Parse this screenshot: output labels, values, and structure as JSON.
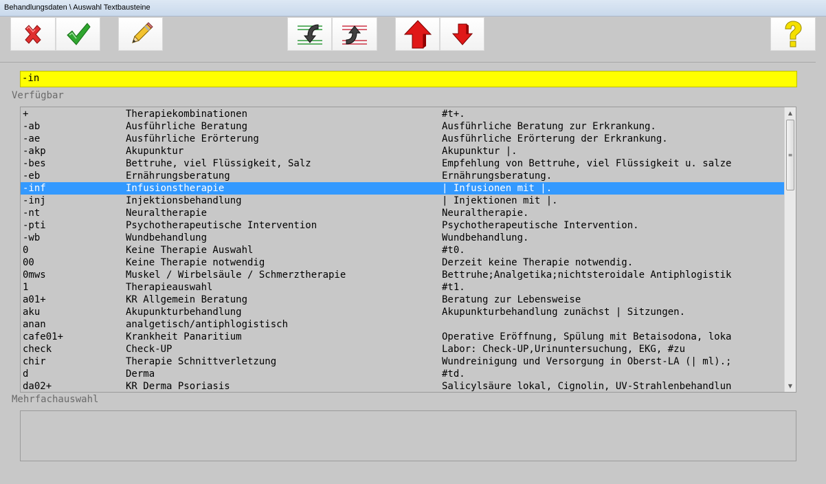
{
  "window": {
    "title": "Behandlungsdaten \\ Auswahl Textbausteine"
  },
  "toolbar": {
    "cancel_icon": "red-x-icon",
    "ok_icon": "green-check-icon",
    "edit_icon": "pencil-icon",
    "move_down_icon": "curved-arrow-down-icon",
    "move_up_icon": "curved-arrow-up-icon",
    "up_icon": "red-arrow-up-icon",
    "down_icon": "red-arrow-down-icon",
    "help_icon": "yellow-question-icon"
  },
  "search": {
    "value": "-in"
  },
  "available": {
    "label": "Verfügbar",
    "selected_index": 6,
    "rows": [
      {
        "code": "+",
        "name": "Therapiekombinationen",
        "text": "#t+."
      },
      {
        "code": "-ab",
        "name": "Ausführliche Beratung",
        "text": "Ausführliche Beratung zur Erkrankung."
      },
      {
        "code": "-ae",
        "name": "Ausführliche Erörterung",
        "text": "Ausführliche Erörterung der Erkrankung."
      },
      {
        "code": "-akp",
        "name": "Akupunktur",
        "text": "Akupunktur |."
      },
      {
        "code": "-bes",
        "name": "Bettruhe, viel Flüssigkeit, Salz",
        "text": "Empfehlung von Bettruhe, viel Flüssigkeit u. salze"
      },
      {
        "code": "-eb",
        "name": "Ernährungsberatung",
        "text": "Ernährungsberatung."
      },
      {
        "code": "-inf",
        "name": "Infusionstherapie",
        "text": "| Infusionen mit |."
      },
      {
        "code": "-inj",
        "name": "Injektionsbehandlung",
        "text": "| Injektionen mit |."
      },
      {
        "code": "-nt",
        "name": "Neuraltherapie",
        "text": "Neuraltherapie."
      },
      {
        "code": "-pti",
        "name": "Psychotherapeutische Intervention",
        "text": "Psychotherapeutische Intervention."
      },
      {
        "code": "-wb",
        "name": "Wundbehandlung",
        "text": "Wundbehandlung."
      },
      {
        "code": "0",
        "name": "Keine Therapie Auswahl",
        "text": "#t0."
      },
      {
        "code": "00",
        "name": "Keine Therapie notwendig",
        "text": "Derzeit keine Therapie notwendig."
      },
      {
        "code": "0mws",
        "name": "Muskel / Wirbelsäule / Schmerztherapie",
        "text": "Bettruhe;Analgetika;nichtsteroidale Antiphlogistik"
      },
      {
        "code": "1",
        "name": "Therapieauswahl",
        "text": "#t1."
      },
      {
        "code": "a01+",
        "name": "KR Allgemein Beratung",
        "text": "Beratung zur Lebensweise"
      },
      {
        "code": "aku",
        "name": "Akupunkturbehandlung",
        "text": "Akupunkturbehandlung zunächst | Sitzungen."
      },
      {
        "code": "anan",
        "name": "analgetisch/antiphlogistisch",
        "text": ""
      },
      {
        "code": "cafe01+",
        "name": "Krankheit Panaritium",
        "text": "Operative Eröffnung, Spülung mit Betaisodona, loka"
      },
      {
        "code": "check",
        "name": "Check-UP",
        "text": "Labor: Check-UP,Urinuntersuchung, EKG, #zu"
      },
      {
        "code": "chir",
        "name": "Therapie Schnittverletzung",
        "text": "Wundreinigung und Versorgung in Oberst-LA (| ml).;"
      },
      {
        "code": "d",
        "name": "Derma",
        "text": "#td."
      },
      {
        "code": "da02+",
        "name": "KR Derma Psoriasis",
        "text": "Salicylsäure lokal, Cignolin, UV-Strahlenbehandlun"
      }
    ]
  },
  "multi": {
    "label": "Mehrfachauswahl"
  }
}
